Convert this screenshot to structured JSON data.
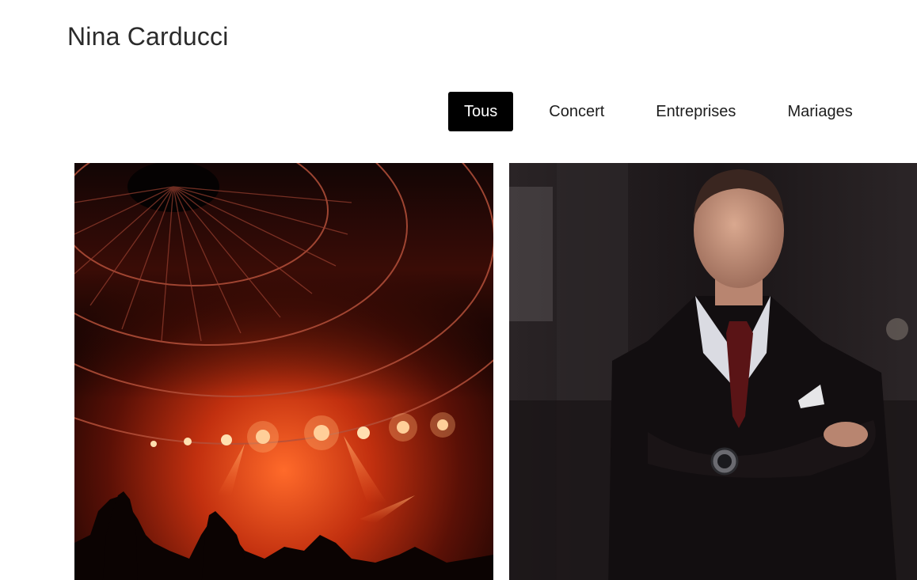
{
  "header": {
    "site_title": "Nina Carducci"
  },
  "filters": {
    "items": [
      {
        "label": "Tous",
        "active": true
      },
      {
        "label": "Concert",
        "active": false
      },
      {
        "label": "Entreprises",
        "active": false
      },
      {
        "label": "Mariages",
        "active": false
      }
    ]
  },
  "gallery": {
    "items": [
      {
        "category": "Concert",
        "depiction": "concert-photo"
      },
      {
        "category": "Entreprises",
        "depiction": "businessman-photo"
      }
    ]
  },
  "colors": {
    "active_filter_bg": "#000000",
    "active_filter_text": "#ffffff",
    "text": "#222222"
  }
}
